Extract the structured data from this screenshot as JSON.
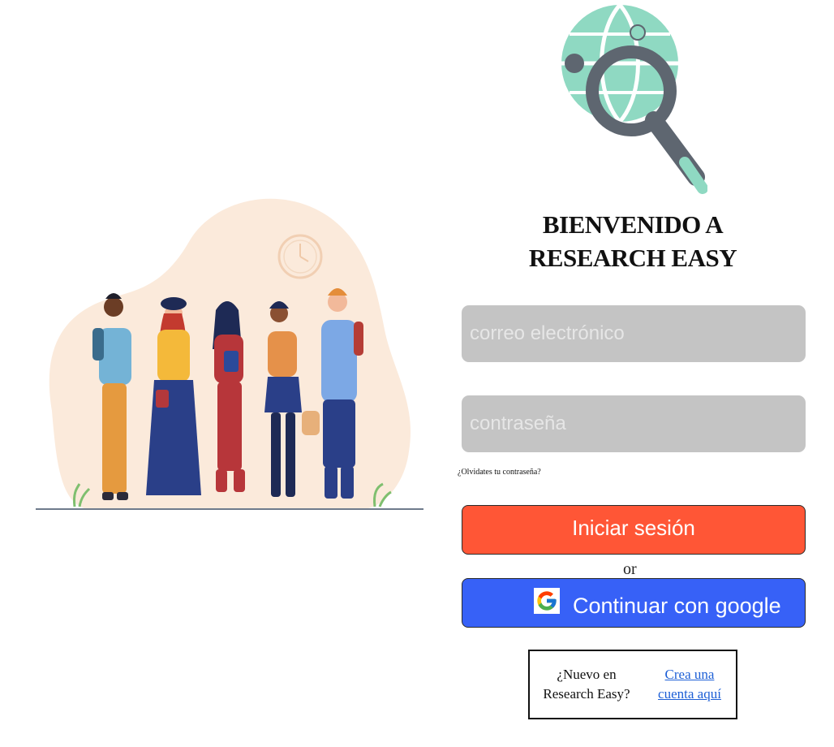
{
  "welcome": {
    "line1": "BIENVENIDO A",
    "line2": "RESEARCH EASY"
  },
  "form": {
    "email_placeholder": "correo electrónico",
    "password_placeholder": "contraseña",
    "forgot_label": "¿Olvidates tu contraseña?",
    "login_label": "Iniciar sesión",
    "or_label": "or",
    "google_label": "Continuar con google"
  },
  "signup": {
    "prompt_line1": "¿Nuevo en",
    "prompt_line2": "Research Easy?",
    "link_line1": "Crea una",
    "link_line2": "cuenta aquí"
  },
  "icons": {
    "logo": "globe-magnifier-icon",
    "illustration": "people-group-illustration",
    "google": "google-g-icon"
  },
  "colors": {
    "field_bg": "#c4c4c4",
    "login_button": "#ff5636",
    "google_button": "#3761f7",
    "logo_teal": "#8fd9c2",
    "logo_gray": "#5e6670",
    "link": "#1d5fd6"
  }
}
